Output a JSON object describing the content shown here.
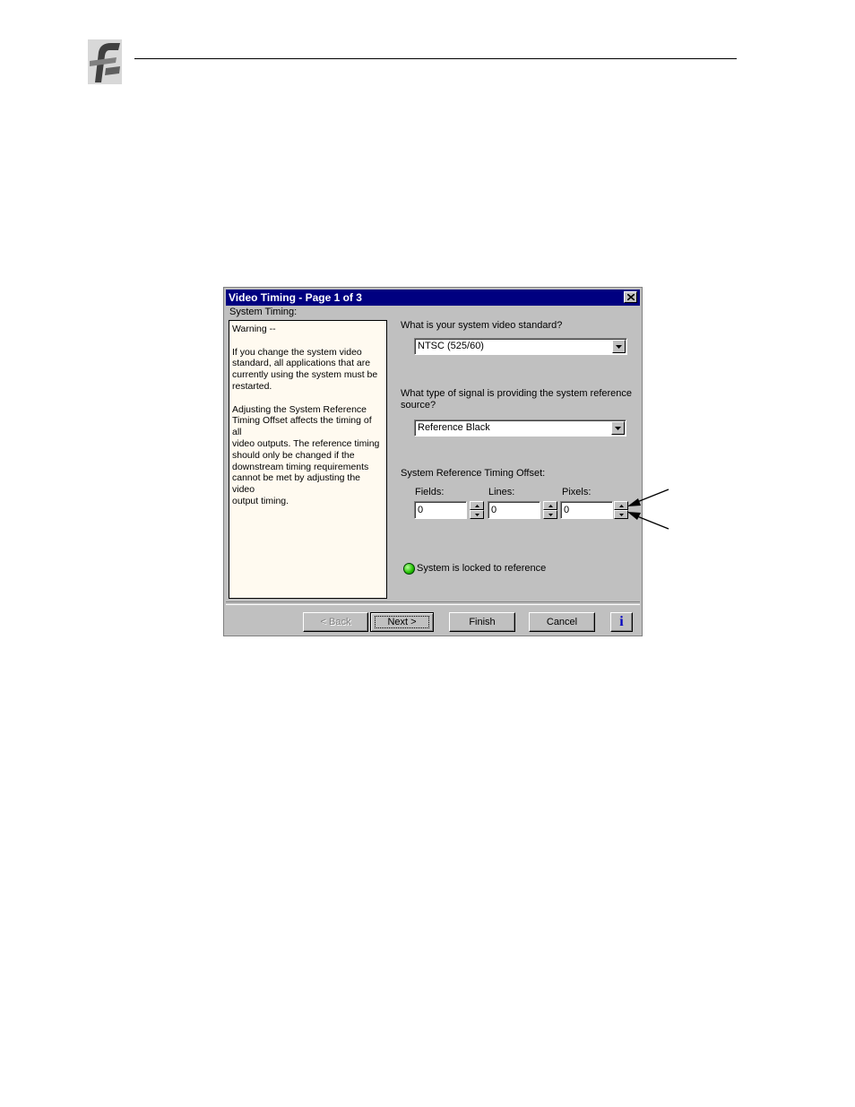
{
  "dialog": {
    "title": "Video Timing - Page 1 of 3",
    "section_label": "System Timing:",
    "warning": {
      "heading": "Warning --",
      "para1_lines": [
        "If you change the system video",
        "standard, all applications that are",
        "currently using the system must be",
        "restarted."
      ],
      "para2_lines": [
        "Adjusting the System Reference",
        "Timing Offset affects the timing of all",
        "video outputs.  The reference timing",
        "should only be changed if the",
        "downstream timing requirements",
        "cannot be met by adjusting the video",
        "output timing."
      ]
    },
    "video_standard": {
      "question": "What is your system video standard?",
      "value": "NTSC (525/60)"
    },
    "reference_source": {
      "question_line1": "What type of signal is providing the system reference",
      "question_line2": "source?",
      "value": "Reference Black"
    },
    "timing_offset": {
      "label": "System Reference Timing Offset:",
      "fields_label": "Fields:",
      "fields_value": "0",
      "lines_label": "Lines:",
      "lines_value": "0",
      "pixels_label": "Pixels:",
      "pixels_value": "0"
    },
    "status_text": "System is locked to reference",
    "buttons": {
      "back": "< Back",
      "next": "Next >",
      "finish": "Finish",
      "cancel": "Cancel",
      "info": "i"
    }
  },
  "colors": {
    "titlebar": "#000080",
    "warning_background": "#fffaf0",
    "status_led": "#22c000"
  }
}
